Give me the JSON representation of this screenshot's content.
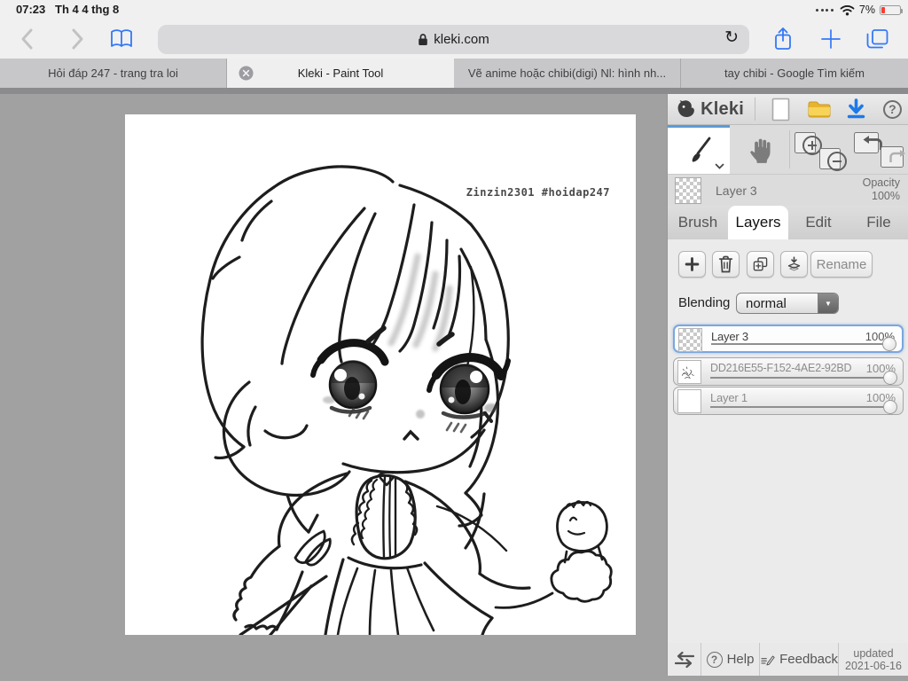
{
  "status_bar": {
    "time": "07:23",
    "date": "Th 4 4 thg 8",
    "battery_percent": "7%"
  },
  "browser": {
    "address": "kleki.com",
    "reload_icon": "↻",
    "tabs": [
      {
        "label": "Hỏi đáp 247 - trang tra loi",
        "active": false
      },
      {
        "label": "Kleki - Paint Tool",
        "active": true
      },
      {
        "label": "Vẽ anime hoặc chibi(digi) Nl: hình nh...",
        "active": false
      },
      {
        "label": "tay chibi - Google Tìm kiếm",
        "active": false
      }
    ]
  },
  "app": {
    "brand": "Kleki",
    "icons": {
      "help_glyph": "?",
      "dropdown_arrow": "▼"
    },
    "current_layer": {
      "name": "Layer 3",
      "opacity_label": "Opacity",
      "opacity_value": "100%"
    },
    "panel_tabs": {
      "brush": "Brush",
      "layers": "Layers",
      "edit": "Edit",
      "file": "File"
    },
    "layers_panel": {
      "rename_label": "Rename",
      "blending_label": "Blending",
      "blending_value": "normal",
      "rows": [
        {
          "name": "Layer 3",
          "opacity": "100%",
          "selected": true
        },
        {
          "name": "DD216E55-F152-4AE2-92BD",
          "opacity": "100%",
          "selected": false
        },
        {
          "name": "Layer 1",
          "opacity": "100%",
          "selected": false
        }
      ]
    },
    "footer": {
      "help_label": "Help",
      "feedback_label": "Feedback",
      "updated_line1": "updated",
      "updated_line2": "2021-06-16"
    },
    "canvas_watermark": "Zinzin2301 #hoidap247"
  },
  "colors": {
    "accent_blue": "#3478f6",
    "battery_red": "#ff3b30",
    "selection_blue": "#7aa7e0",
    "folder_yellow": "#f0c02e",
    "download_blue": "#1d79e8"
  }
}
